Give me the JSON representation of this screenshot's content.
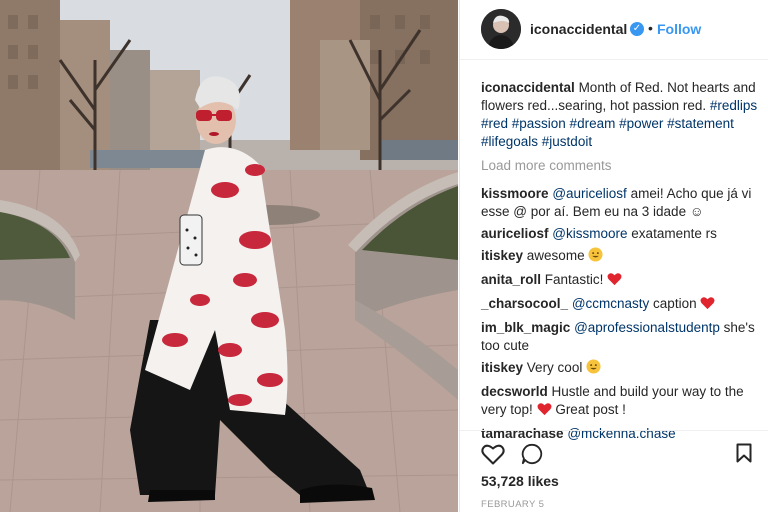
{
  "post": {
    "username": "iconaccidental",
    "follow_label": "Follow",
    "separator": "•",
    "verified_mark": "✓"
  },
  "caption": {
    "username": "iconaccidental",
    "text": "Month of Red. Not hearts and flowers red...searing, hot passion red.",
    "hashtags": "#redlips #red #passion #dream #power #statement #lifegoals #justdoit"
  },
  "load_more_label": "Load more comments",
  "comments": [
    {
      "user": "kissmoore",
      "mention": "@auriceliosf",
      "text": "amei! Acho que já vi esse @ por aí. Bem eu na 3 idade ☺"
    },
    {
      "user": "auriceliosf",
      "mention": "@kissmoore",
      "text": "exatamente rs"
    },
    {
      "user": "itiskey",
      "text": "awesome",
      "emoji": "smile-emoji"
    },
    {
      "user": "anita_roll",
      "text": "Fantastic!",
      "emoji": "heart-emoji"
    },
    {
      "user": "_charsocool_",
      "mention": "@ccmcnasty",
      "text": "caption",
      "emoji": "heart-emoji"
    },
    {
      "user": "im_blk_magic",
      "mention": "@aprofessionalstudentp",
      "text": "she's too cute"
    },
    {
      "user": "itiskey",
      "text": "Very cool",
      "emoji": "smile-emoji"
    },
    {
      "user": "decsworld",
      "text": "Hustle and build your way to the very top!",
      "text2": "Great post !",
      "emoji": "heart-emoji"
    },
    {
      "user": "tamarachase",
      "mention": "@mckenna.chase",
      "text": ""
    }
  ],
  "likes": "53,728 likes",
  "date": "FEBRUARY 5",
  "icons": {
    "like": "heart-outline-icon",
    "comment": "comment-bubble-icon",
    "save": "bookmark-icon"
  },
  "colors": {
    "link": "#3897f0",
    "mention": "#003569",
    "muted": "#999999",
    "heart_red": "#ed4956"
  }
}
